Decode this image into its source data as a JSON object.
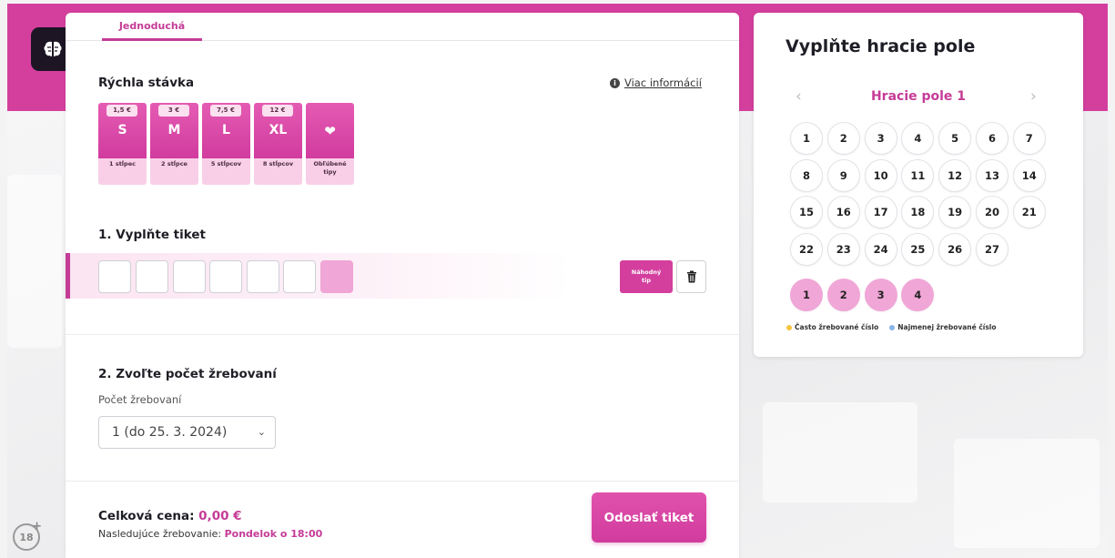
{
  "tabs": [
    {
      "label": "Jednoduchá"
    }
  ],
  "quick_bet": {
    "title": "Rýchla stávka",
    "info_link": "Viac informácií",
    "options": [
      {
        "price": "1,5 €",
        "size": "S",
        "desc": "1 stĺpec"
      },
      {
        "price": "3 €",
        "size": "M",
        "desc": "2 stĺpce"
      },
      {
        "price": "7,5 €",
        "size": "L",
        "desc": "5 stĺpcov"
      },
      {
        "price": "12 €",
        "size": "XL",
        "desc": "8 stĺpcov"
      }
    ],
    "favorite": {
      "desc": "Obľúbené tipy",
      "icon": "heart-icon"
    }
  },
  "ticket": {
    "title": "1. Vyplňte tiket",
    "random_label": "Náhodný tip",
    "main_count": 6,
    "extra_count": 1
  },
  "draws": {
    "title": "2. Zvoľte počet žrebovaní",
    "field_label": "Počet žrebovaní",
    "selected": "1 (do 25. 3. 2024)"
  },
  "footer": {
    "total_label": "Celková cena:",
    "total_value": "0,00 €",
    "next_label": "Nasledujúce žrebovanie:",
    "next_value": "Pondelok o 18:00",
    "submit": "Odoslať tiket"
  },
  "side": {
    "title": "Vyplňte hracie pole",
    "field_name": "Hracie pole 1",
    "numbers": [
      "1",
      "2",
      "3",
      "4",
      "5",
      "6",
      "7",
      "8",
      "9",
      "10",
      "11",
      "12",
      "13",
      "14",
      "15",
      "16",
      "17",
      "18",
      "19",
      "20",
      "21",
      "22",
      "23",
      "24",
      "25",
      "26",
      "27"
    ],
    "extra_numbers": [
      "1",
      "2",
      "3",
      "4"
    ],
    "legend": [
      {
        "label": "Často žrebované číslo",
        "color": "#f5c542"
      },
      {
        "label": "Najmenej žrebované číslo",
        "color": "#8ab4e8"
      }
    ]
  },
  "age_badge": "18",
  "colors": {
    "accent": "#d43f9e",
    "accent_light": "#f0a6d6"
  }
}
